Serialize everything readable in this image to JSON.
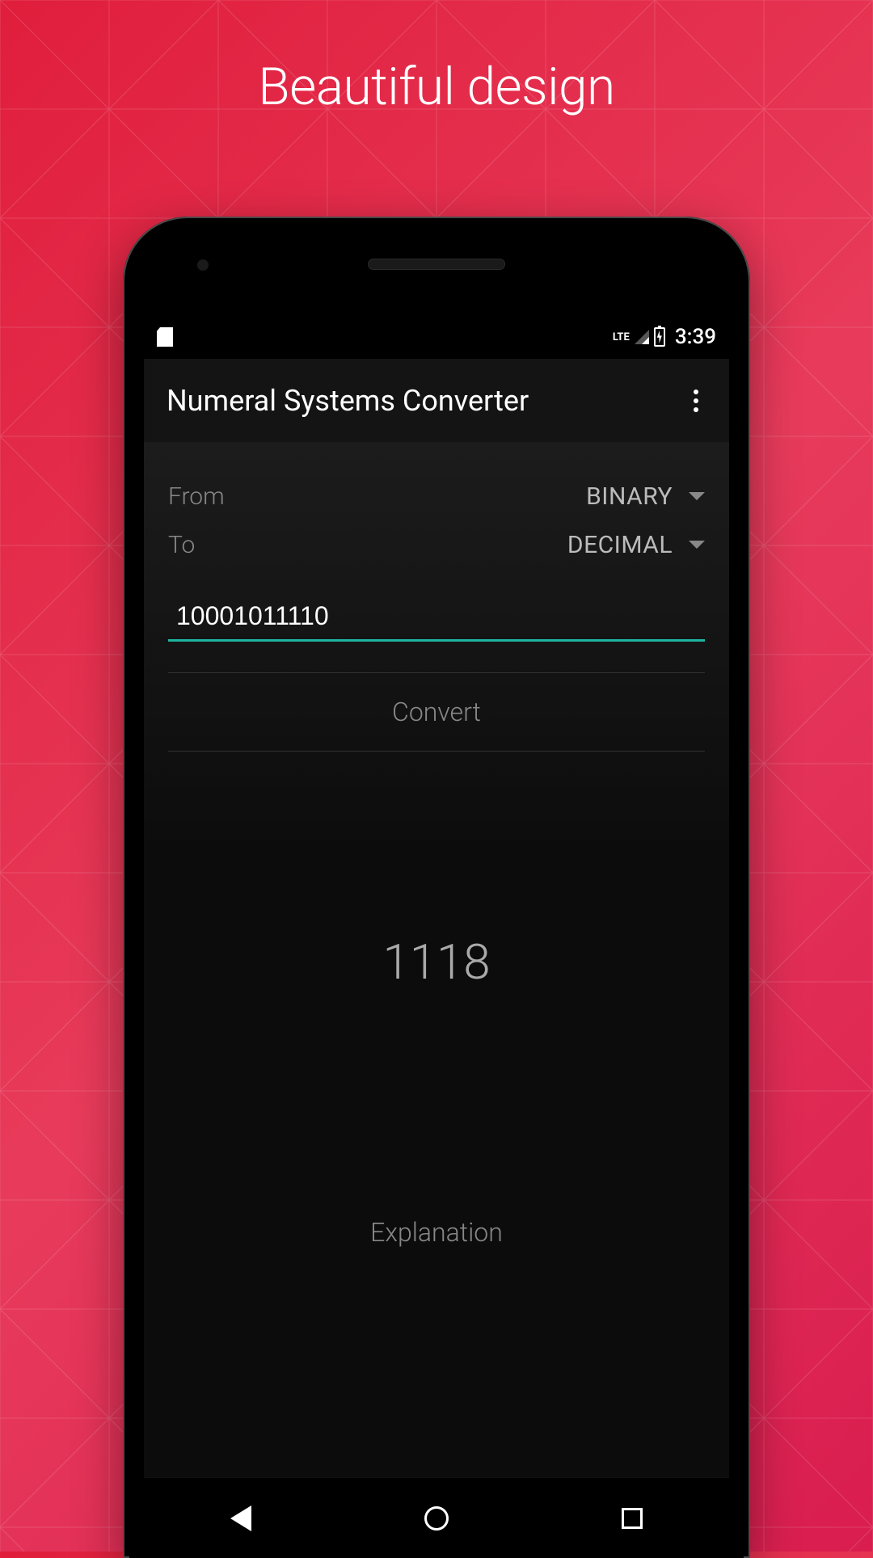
{
  "headline": "Beautiful design",
  "statusbar": {
    "network": "LTE",
    "time": "3:39"
  },
  "appbar": {
    "title": "Numeral Systems Converter"
  },
  "converter": {
    "from_label": "From",
    "from_value": "BINARY",
    "to_label": "To",
    "to_value": "DECIMAL",
    "input_value": "10001011110",
    "convert_label": "Convert",
    "result": "1118",
    "explanation_label": "Explanation"
  }
}
